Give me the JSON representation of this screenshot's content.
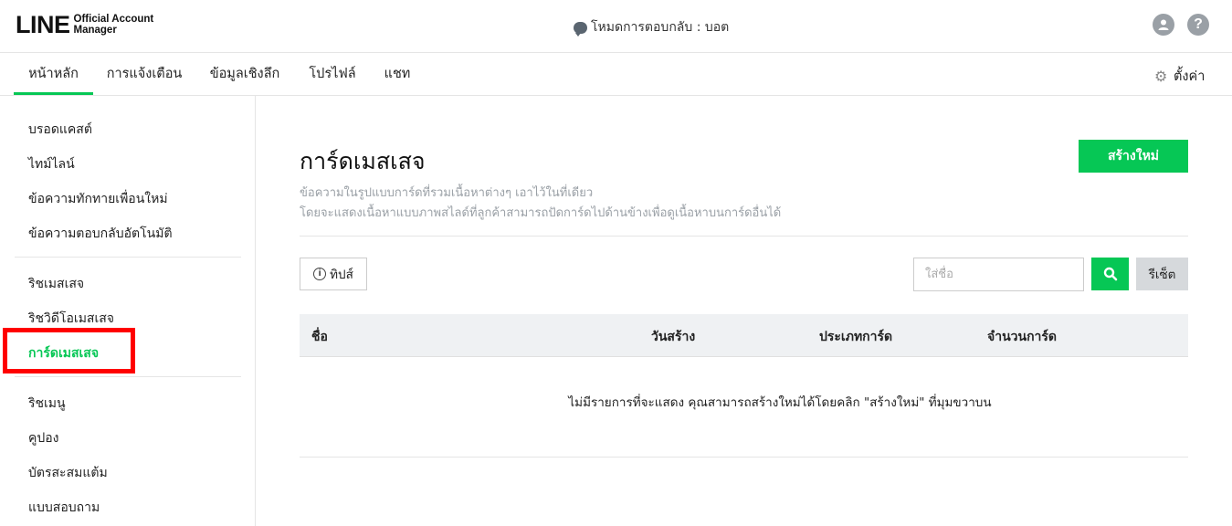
{
  "header": {
    "logo_mark": "LINE",
    "logo_sub_1": "Official Account",
    "logo_sub_2": "Manager",
    "mode_text": "โหมดการตอบกลับ : บอต"
  },
  "nav": {
    "tabs": [
      {
        "label": "หน้าหลัก",
        "active": true
      },
      {
        "label": "การแจ้งเตือน",
        "active": false
      },
      {
        "label": "ข้อมูลเชิงลึก",
        "active": false
      },
      {
        "label": "โปรไฟล์",
        "active": false
      },
      {
        "label": "แชท",
        "active": false
      }
    ],
    "settings_label": "ตั้งค่า"
  },
  "sidebar": {
    "group1": [
      "บรอดแคสต์",
      "ไทม์ไลน์",
      "ข้อความทักทายเพื่อนใหม่",
      "ข้อความตอบกลับอัตโนมัติ"
    ],
    "group2": [
      "ริชเมสเสจ",
      "ริชวิดีโอเมสเสจ",
      "การ์ดเมสเสจ"
    ],
    "group3": [
      "ริชเมนู",
      "คูปอง",
      "บัตรสะสมแต้ม",
      "แบบสอบถาม"
    ],
    "active_item": "การ์ดเมสเสจ"
  },
  "main": {
    "title": "การ์ดเมสเสจ",
    "desc_line1": "ข้อความในรูปแบบการ์ดที่รวมเนื้อหาต่างๆ เอาไว้ในที่เดียว",
    "desc_line2": "โดยจะแสดงเนื้อหาแบบภาพสไลด์ที่ลูกค้าสามารถปัดการ์ดไปด้านข้างเพื่อดูเนื้อหาบนการ์ดอื่นได้",
    "create_button": "สร้างใหม่",
    "tips_button": "ทิปส์",
    "search_placeholder": "ใส่ชื่อ",
    "reset_button": "รีเซ็ต",
    "table_headers": {
      "name": "ชื่อ",
      "created": "วันสร้าง",
      "card_type": "ประเภทการ์ด",
      "card_count": "จำนวนการ์ด"
    },
    "empty_message": "ไม่มีรายการที่จะแสดง คุณสามารถสร้างใหม่ได้โดยคลิก \"สร้างใหม่\" ที่มุมขวาบน"
  },
  "colors": {
    "accent": "#06c755",
    "highlight": "#ff0000",
    "table_header_bg": "#eff1f3"
  }
}
